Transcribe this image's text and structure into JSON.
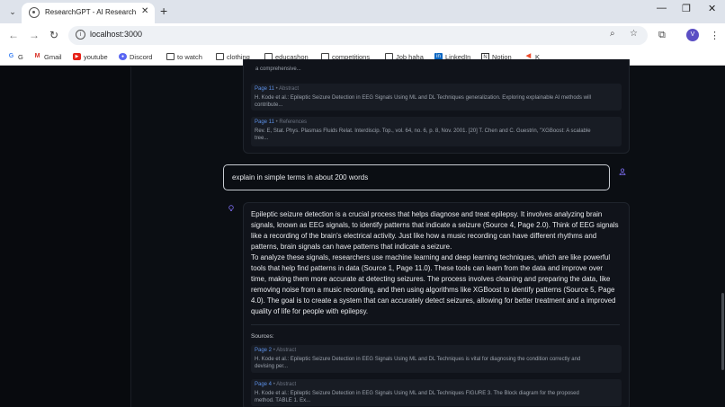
{
  "browser": {
    "tab_title": "ResearchGPT - AI Research Pap",
    "url": "localhost:3000",
    "profile_initial": "V",
    "bookmarks": [
      "G",
      "Gmail",
      "youtube",
      "Discord",
      "to watch",
      "clothing",
      "educashon",
      "competitions",
      "Job haha",
      "LinkedIn",
      "Notion",
      "K"
    ]
  },
  "chat": {
    "prev_truncated": "a comprehensive...",
    "prev_sources": [
      {
        "page": "Page 11",
        "section": "Abstract",
        "snippet": [
          "H. Kode et al.: Epileptic Seizure Detection in EEG Signals Using ML and DL Techniques generalization. Exploring explainable AI methods will",
          "contribute..."
        ]
      },
      {
        "page": "Page 11",
        "section": "References",
        "snippet": [
          "Rev. E, Stat. Phys. Plasmas Fluids Relat. Interdiscip. Top., vol. 64, no. 6, p. 8, Nov. 2001. [20] T. Chen and C. Guestrin, \"XGBoost: A scalable",
          "tree..."
        ]
      }
    ],
    "user_message": "explain in simple terms in about 200 words",
    "answer_paragraphs": [
      "Epileptic seizure detection is a crucial process that helps diagnose and treat epilepsy. It involves analyzing brain signals, known as EEG signals, to identify patterns that indicate a seizure (Source 4, Page 2.0). Think of EEG signals like a recording of the brain's electrical activity. Just like how a music recording can have different rhythms and patterns, brain signals can have patterns that indicate a seizure.",
      "To analyze these signals, researchers use machine learning and deep learning techniques, which are like powerful tools that help find patterns in data (Source 1, Page 11.0). These tools can learn from the data and improve over time, making them more accurate at detecting seizures. The process involves cleaning and preparing the data, like removing noise from a music recording, and then using algorithms like XGBoost to identify patterns (Source 5, Page 4.0). The goal is to create a system that can accurately detect seizures, allowing for better treatment and a improved quality of life for people with epilepsy."
    ],
    "sources_label": "Sources:",
    "sources": [
      {
        "page": "Page 2",
        "section": "Abstract",
        "snippet": [
          "H. Kode et al.: Epileptic Seizure Detection in EEG Signals Using ML and DL Techniques is vital for diagnosing the condition correctly and",
          "devising per..."
        ]
      },
      {
        "page": "Page 4",
        "section": "Abstract",
        "snippet": [
          "H. Kode et al.: Epileptic Seizure Detection in EEG Signals Using ML and DL Techniques FIGURE 3. The Block diagram for the proposed",
          "method. TABLE 1. Ex..."
        ]
      }
    ]
  },
  "icons": {
    "user": "user-icon",
    "assistant": "lightbulb-icon"
  }
}
